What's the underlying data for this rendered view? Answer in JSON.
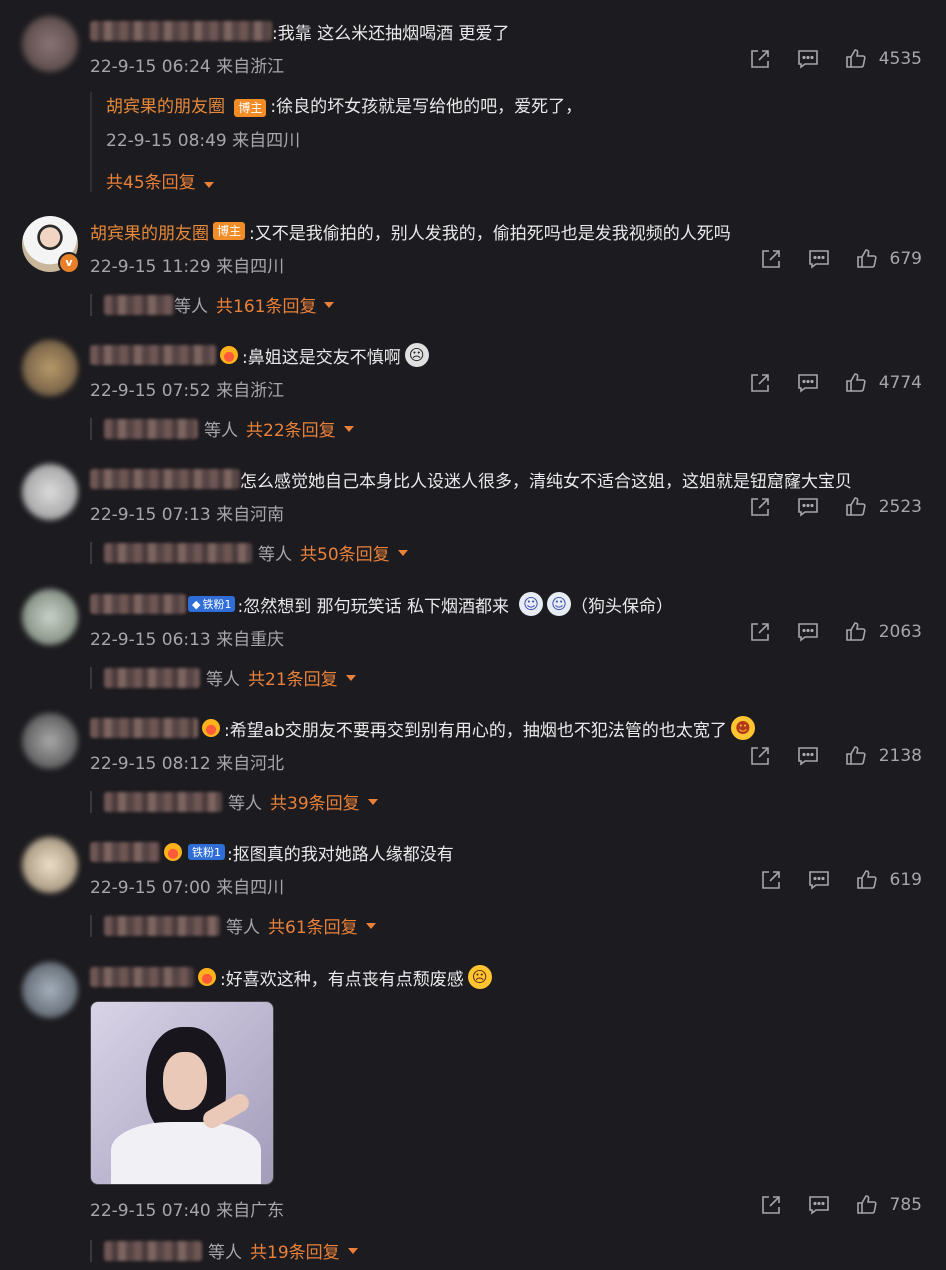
{
  "icons": {
    "share": "share-icon",
    "comment": "comment-icon",
    "like": "thumbs-up-icon"
  },
  "comments": [
    {
      "text": ":我靠 这么米还抽烟喝酒 更爱了",
      "meta": "22-9-15 06:24 来自浙江",
      "likes": "4535",
      "sub_reply": {
        "author": "胡宾果的朋友圈",
        "badge": "博主",
        "text": ":徐良的坏女孩就是写给他的吧，爱死了，",
        "meta": "22-9-15 08:49 来自四川",
        "more": "共45条回复"
      }
    },
    {
      "author": "胡宾果的朋友圈",
      "badge": "博主",
      "text": ":又不是我偷拍的，别人发我的，偷拍死吗也是发我视频的人死吗",
      "meta": "22-9-15 11:29 来自四川",
      "likes": "679",
      "reply_others": "等人",
      "reply_more": "共161条回复"
    },
    {
      "text": ":鼻姐这是交友不慎啊",
      "meta": "22-9-15 07:52 来自浙江",
      "likes": "4774",
      "reply_others": "等人",
      "reply_more": "共22条回复"
    },
    {
      "text": "怎么感觉她自己本身比人设迷人很多，清纯女不适合这姐，这姐就是钮窟窿大宝贝",
      "meta": "22-9-15 07:13 来自河南",
      "likes": "2523",
      "reply_others": "等人",
      "reply_more": "共50条回复"
    },
    {
      "fan_badge": "铁粉1",
      "text": ":忽然想到 那句玩笑话 私下烟酒都来",
      "text_tail": "（狗头保命）",
      "meta": "22-9-15 06:13 来自重庆",
      "likes": "2063",
      "reply_others": "等人",
      "reply_more": "共21条回复"
    },
    {
      "text": ":希望ab交朋友不要再交到别有用心的，抽烟也不犯法管的也太宽了",
      "meta": "22-9-15 08:12 来自河北",
      "likes": "2138",
      "reply_others": "等人",
      "reply_more": "共39条回复"
    },
    {
      "fan_badge": "铁粉1",
      "text": ":抠图真的我对她路人缘都没有",
      "meta": "22-9-15 07:00 来自四川",
      "likes": "619",
      "reply_others": "等人",
      "reply_more": "共61条回复"
    },
    {
      "text": ":好喜欢这种，有点丧有点颓废感",
      "meta": "22-9-15 07:40 来自广东",
      "likes": "785",
      "reply_others": "等人",
      "reply_more": "共19条回复"
    }
  ]
}
